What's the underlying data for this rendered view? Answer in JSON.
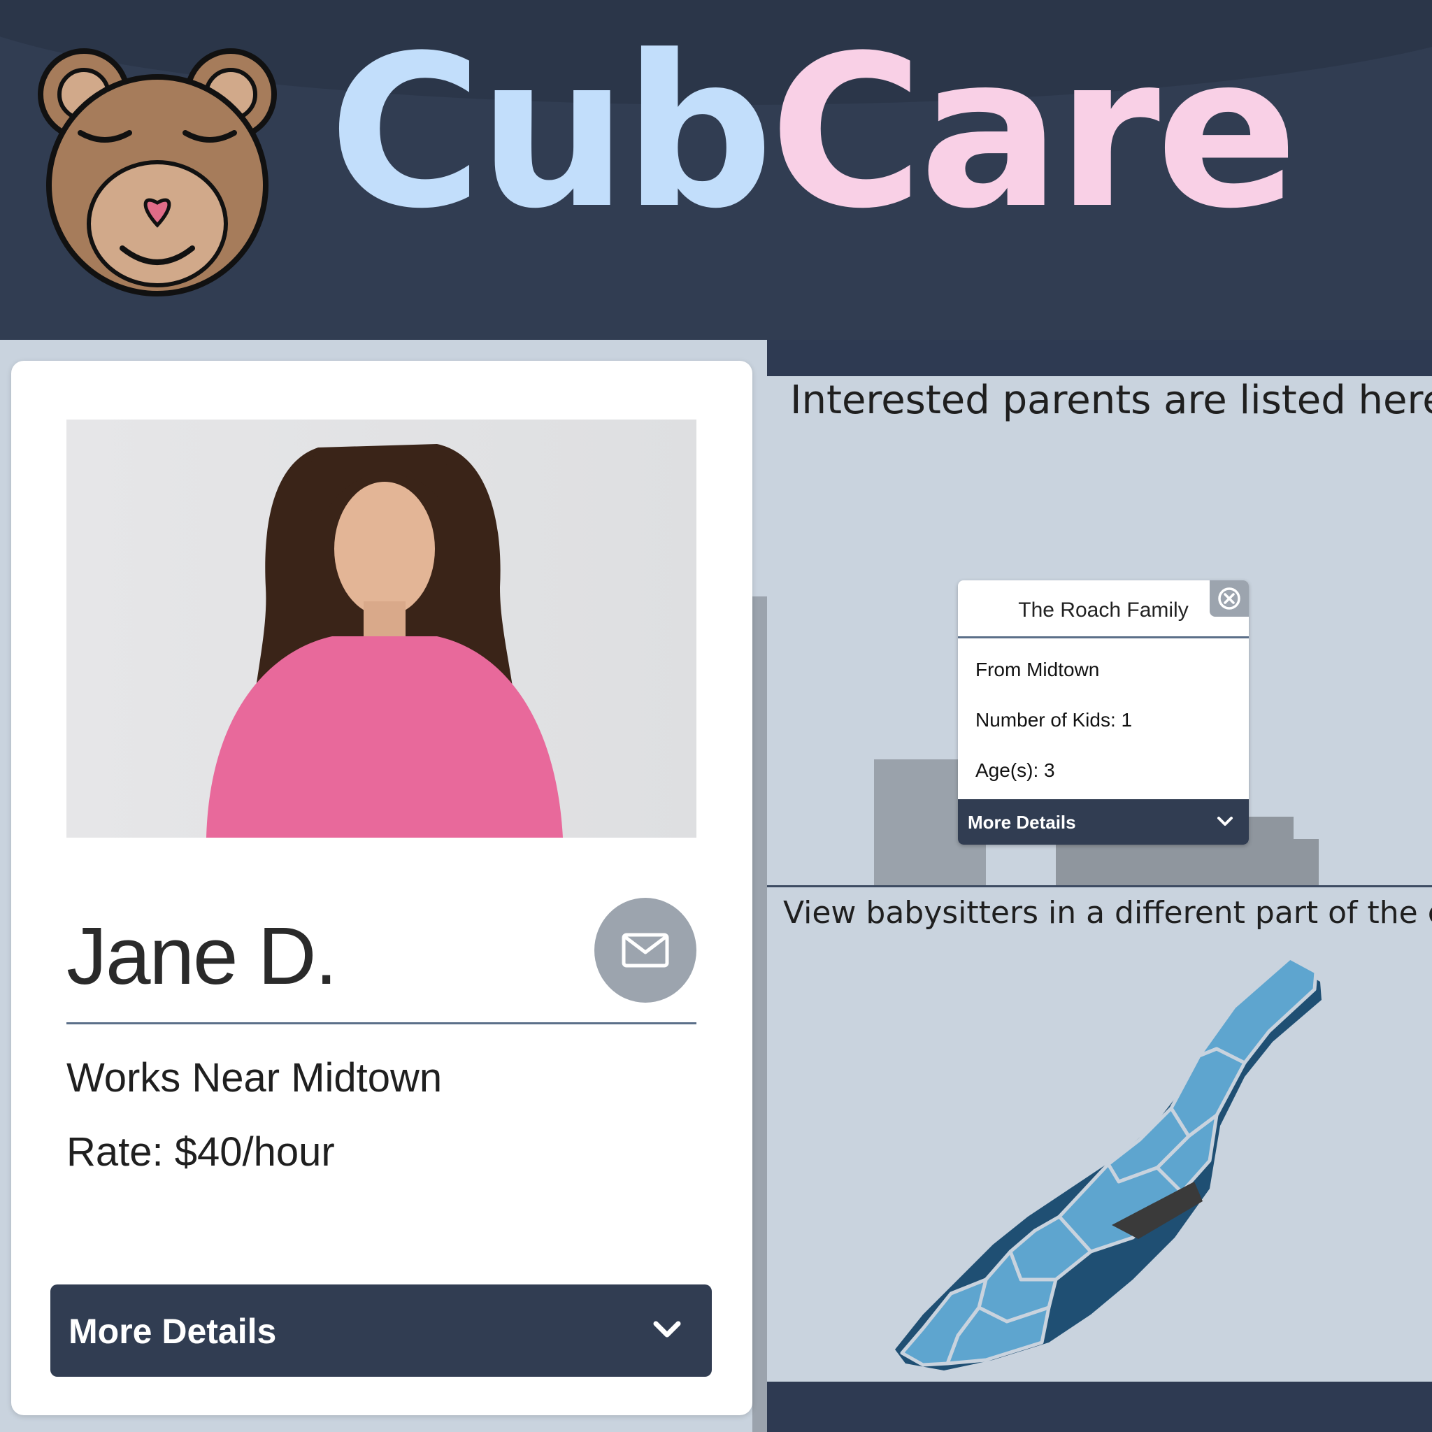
{
  "header": {
    "brand_part1": "Cub",
    "brand_part2": "Care",
    "colors": {
      "cub": "#c2defb",
      "care": "#f9d0e6",
      "background": "#313d52"
    }
  },
  "sitter_card": {
    "name": "Jane D.",
    "works_near": "Works Near Midtown",
    "rate": "Rate: $40/hour",
    "more_details_label": "More Details",
    "icons": {
      "contact": "mail-icon",
      "expand": "chevron-down-icon"
    }
  },
  "parents_panel": {
    "heading": "Interested parents are listed here.",
    "popup": {
      "title": "The Roach Family",
      "from": "From Midtown",
      "kids": "Number of Kids: 1",
      "ages": "Age(s): 3",
      "more_details_label": "More Details",
      "icons": {
        "close": "close-circle-icon",
        "expand": "chevron-down-icon"
      }
    }
  },
  "map_panel": {
    "heading": "View babysitters in a different part of the city",
    "map_color": "#5ea5cf",
    "highlight_color": "#3a3a3a"
  }
}
